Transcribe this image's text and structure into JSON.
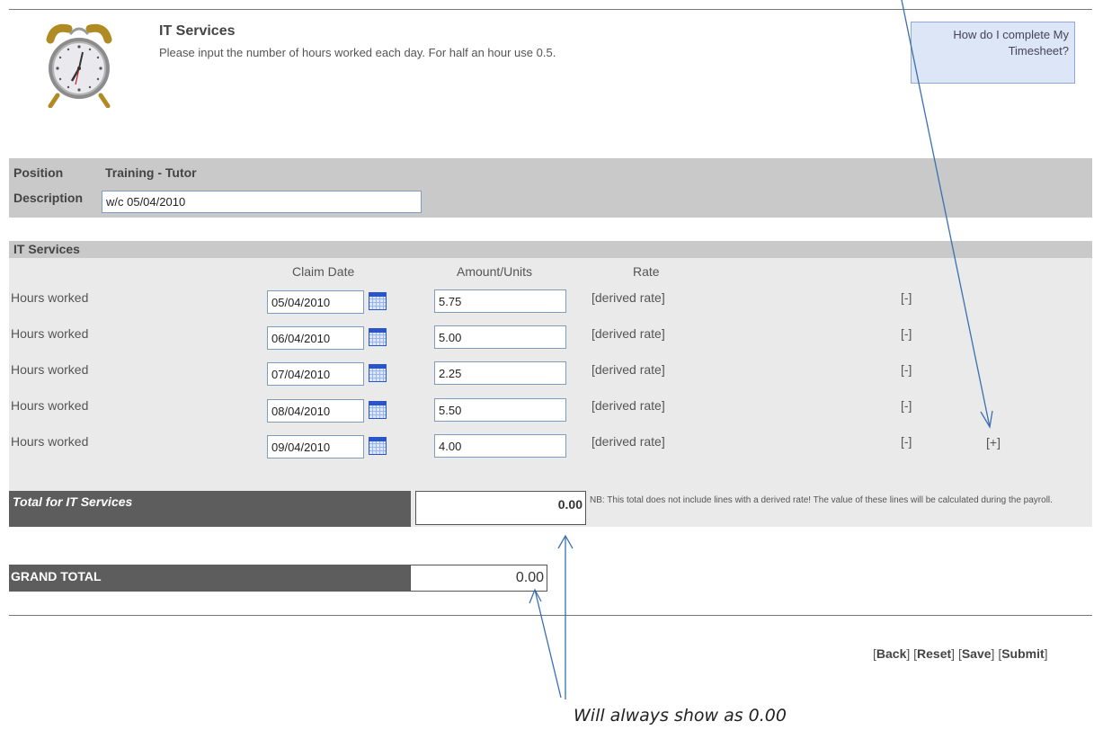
{
  "header": {
    "title": "IT Services",
    "instructions": "Please input the number of hours worked each day. For half an hour use 0.5.",
    "help_link": "How do I complete My Timesheet?"
  },
  "position": {
    "position_label": "Position",
    "position_value": "Training - Tutor",
    "description_label": "Description",
    "description_value": "w/c 05/04/2010"
  },
  "section": {
    "title": "IT Services",
    "col_claim_date": "Claim Date",
    "col_amount": "Amount/Units",
    "col_rate": "Rate",
    "rows": [
      {
        "label": "Hours worked",
        "date": "05/04/2010",
        "amount": "5.75",
        "rate": "[derived rate]",
        "remove": "[-]"
      },
      {
        "label": "Hours worked",
        "date": "06/04/2010",
        "amount": "5.00",
        "rate": "[derived rate]",
        "remove": "[-]"
      },
      {
        "label": "Hours worked",
        "date": "07/04/2010",
        "amount": "2.25",
        "rate": "[derived rate]",
        "remove": "[-]"
      },
      {
        "label": "Hours worked",
        "date": "08/04/2010",
        "amount": "5.50",
        "rate": "[derived rate]",
        "remove": "[-]"
      },
      {
        "label": "Hours worked",
        "date": "09/04/2010",
        "amount": "4.00",
        "rate": "[derived rate]",
        "remove": "[-]"
      }
    ],
    "add": "[+]",
    "total_label": "Total for IT Services",
    "total_value": "0.00",
    "note": "NB: This total does not include lines with a derived rate! The value of these lines will be calculated during the payroll."
  },
  "grand": {
    "label": "GRAND TOTAL",
    "value": "0.00"
  },
  "actions": {
    "back": "Back",
    "reset": "Reset",
    "save": "Save",
    "submit": "Submit"
  },
  "annotation": "Will always show as 0.00",
  "colors": {
    "arrow": "#3a6fb0",
    "gray_band": "#c9c9c9",
    "dark_band": "#5d5d5d",
    "help_bg": "#dde6f7"
  }
}
